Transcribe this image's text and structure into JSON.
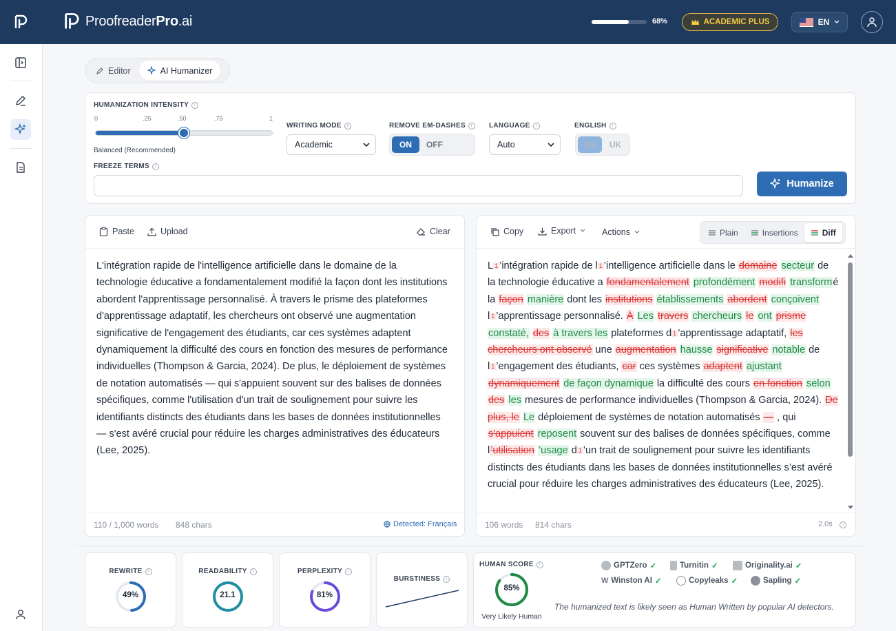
{
  "app": {
    "brand_light": "Proofreader",
    "brand_bold": "Pro",
    "brand_suffix": ".ai"
  },
  "header": {
    "usage_percent": 68,
    "usage_label": "68%",
    "plan_label": "ACADEMIC PLUS",
    "language_label": "EN"
  },
  "tabs": [
    {
      "label": "Editor",
      "active": false
    },
    {
      "label": "AI Humanizer",
      "active": true
    }
  ],
  "settings": {
    "intensity_label": "HUMANIZATION INTENSITY",
    "intensity_ticks": [
      "0",
      ".25",
      ".50",
      ".75",
      "1"
    ],
    "intensity_value": 0.5,
    "intensity_caption": "Balanced (Recommended)",
    "writing_mode_label": "WRITING MODE",
    "writing_mode_value": "Academic",
    "em_dash_label": "REMOVE EM-DASHES",
    "em_dash_on": "ON",
    "em_dash_off": "OFF",
    "language_label": "LANGUAGE",
    "language_value": "Auto",
    "english_label": "ENGLISH",
    "english_us": "US",
    "english_uk": "UK",
    "freeze_label": "FREEZE TERMS",
    "freeze_value": "",
    "humanize_label": "Humanize"
  },
  "input_panel": {
    "paste_label": "Paste",
    "upload_label": "Upload",
    "clear_label": "Clear",
    "text": "L'intégration rapide de l'intelligence artificielle dans le domaine de la technologie éducative a fondamentalement modifié la façon dont les institutions abordent l'apprentissage personnalisé. À travers le prisme des plateformes d'apprentissage adaptatif, les chercheurs ont observé une augmentation significative de l'engagement des étudiants, car ces systèmes adaptent dynamiquement la difficulté des cours en fonction des mesures de performance individuelles (Thompson & Garcia, 2024). De plus, le déploiement de systèmes de notation automatisés — qui s'appuient souvent sur des balises de données spécifiques, comme l'utilisation d'un trait de soulignement pour suivre les identifiants distincts des étudiants dans les bases de données institutionnelles — s'est avéré crucial pour réduire les charges administratives des éducateurs (Lee, 2025).",
    "word_count": "110 / 1,000 words",
    "char_count": "848 chars",
    "detected": "Detected: Français"
  },
  "output_panel": {
    "copy_label": "Copy",
    "export_label": "Export",
    "actions_label": "Actions",
    "views": [
      {
        "label": "Plain",
        "active": false
      },
      {
        "label": "Insertions",
        "active": false
      },
      {
        "label": "Diff",
        "active": true
      }
    ],
    "word_count": "106 words",
    "char_count": "814 chars",
    "time": "2.0s"
  },
  "metrics": {
    "rewrite": {
      "label": "REWRITE",
      "value": 49,
      "display": "49%",
      "color": "#2e6db4"
    },
    "readability": {
      "label": "READABILITY",
      "value": 21.1,
      "display": "21.1",
      "color": "#1e8fa0"
    },
    "perplexity": {
      "label": "PERPLEXITY",
      "value": 81,
      "display": "81%",
      "color": "#6a4bd8"
    },
    "burstiness": {
      "label": "BURSTINESS"
    },
    "human_score": {
      "label": "HUMAN SCORE",
      "value": 85,
      "display": "85%",
      "caption": "Very Likely Human",
      "color": "#1e8a44"
    }
  },
  "detectors": [
    {
      "name": "GPTZero",
      "passed": true
    },
    {
      "name": "Turnitin",
      "passed": true
    },
    {
      "name": "Originality.ai",
      "passed": true
    },
    {
      "name": "Winston AI",
      "passed": true
    },
    {
      "name": "Copyleaks",
      "passed": true
    },
    {
      "name": "Sapling",
      "passed": true
    }
  ],
  "detector_note": "The humanized text is likely seen as Human Written by popular AI detectors."
}
